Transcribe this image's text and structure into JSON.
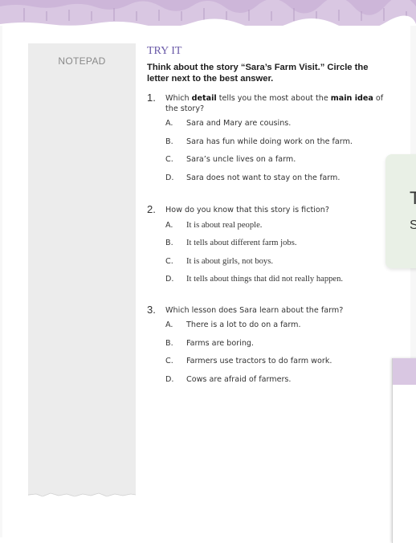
{
  "notepad": {
    "label": "NOTEPAD"
  },
  "section": {
    "heading": "TRY IT",
    "instructions": "Think about the story “Sara’s Farm Visit.” Circle the letter next to the best answer."
  },
  "questions": [
    {
      "number": "1.",
      "text_parts": [
        "Which ",
        "detail",
        " tells you the most about the ",
        "main idea",
        " of the story?"
      ],
      "options": [
        {
          "letter": "A.",
          "text": "Sara and Mary are cousins."
        },
        {
          "letter": "B.",
          "text": "Sara has fun while doing work on the farm."
        },
        {
          "letter": "C.",
          "text": "Sara’s uncle lives on a farm."
        },
        {
          "letter": "D.",
          "text": "Sara does not want to stay on the farm."
        }
      ]
    },
    {
      "number": "2.",
      "text": "How do you know that this story is fiction?",
      "options": [
        {
          "letter": "A.",
          "text": "It is about real people."
        },
        {
          "letter": "B.",
          "text": "It tells about different farm jobs."
        },
        {
          "letter": "C.",
          "text": "It is about girls, not boys."
        },
        {
          "letter": "D.",
          "text": "It tells about things that did not really happen."
        }
      ]
    },
    {
      "number": "3.",
      "text": "Which lesson does Sara learn about the farm?",
      "options": [
        {
          "letter": "A.",
          "text": "There is a lot to do on a farm."
        },
        {
          "letter": "B.",
          "text": "Farms are boring."
        },
        {
          "letter": "C.",
          "text": "Farmers use tractors to do farm work."
        },
        {
          "letter": "D.",
          "text": "Cows are afraid of farmers."
        }
      ]
    }
  ],
  "popup": {
    "line1": "T",
    "line2": "S"
  },
  "colors": {
    "heading": "#6a5aa8",
    "ruler": "#d9c7e2",
    "notepad": "#ececec",
    "popup": "#e9f0e6"
  }
}
